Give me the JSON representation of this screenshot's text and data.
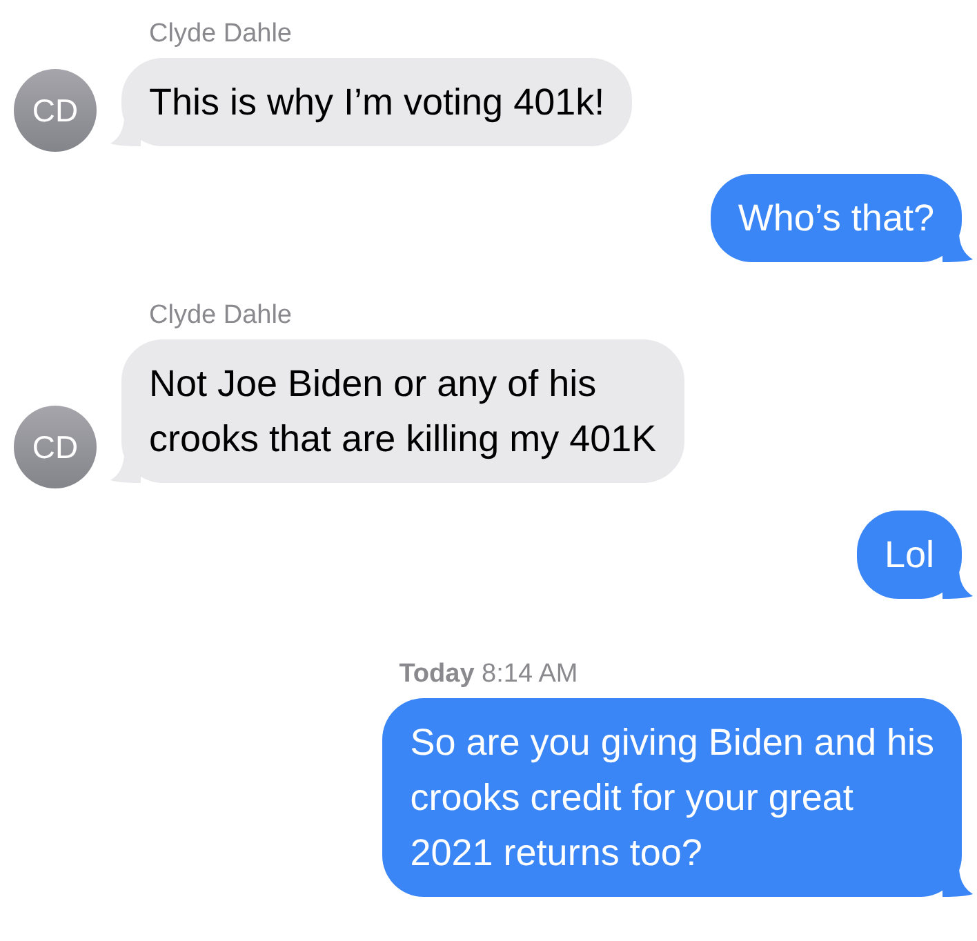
{
  "messages": [
    {
      "kind": "incoming",
      "sender": "Clyde Dahle",
      "avatar": "CD",
      "lines": [
        "This is why I’m voting 401k!"
      ]
    },
    {
      "kind": "outgoing",
      "lines": [
        "Who’s that?"
      ]
    },
    {
      "kind": "incoming",
      "sender": "Clyde Dahle",
      "avatar": "CD",
      "lines": [
        "Not Joe Biden or any of his",
        "crooks that are killing my 401K"
      ]
    },
    {
      "kind": "outgoing",
      "lines": [
        "Lol"
      ]
    },
    {
      "kind": "timestamp",
      "text": "**Today** 8:14 AM"
    },
    {
      "kind": "outgoing",
      "lines": [
        "So are you giving Biden and his",
        "crooks credit for your great",
        "2021 returns too?"
      ]
    }
  ]
}
